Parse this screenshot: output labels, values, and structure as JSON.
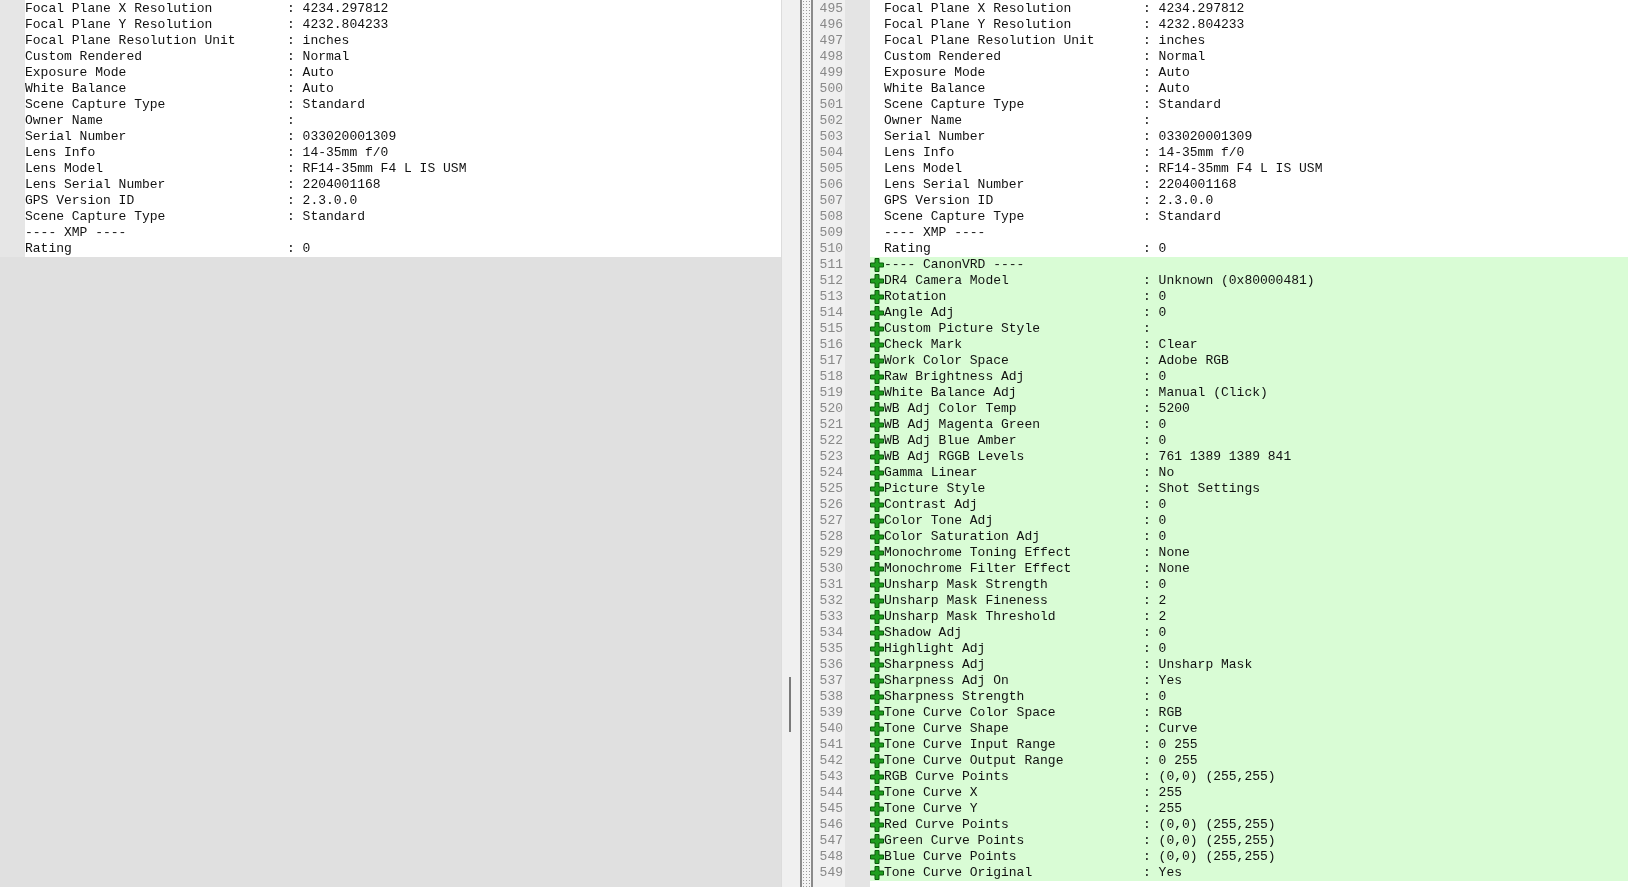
{
  "left_pane": {
    "lines": [
      {
        "key": "Focal Plane X Resolution",
        "value": ": 4234.297812"
      },
      {
        "key": "Focal Plane Y Resolution",
        "value": ": 4232.804233"
      },
      {
        "key": "Focal Plane Resolution Unit",
        "value": ": inches"
      },
      {
        "key": "Custom Rendered",
        "value": ": Normal"
      },
      {
        "key": "Exposure Mode",
        "value": ": Auto"
      },
      {
        "key": "White Balance",
        "value": ": Auto"
      },
      {
        "key": "Scene Capture Type",
        "value": ": Standard"
      },
      {
        "key": "Owner Name",
        "value": ":"
      },
      {
        "key": "Serial Number",
        "value": ": 033020001309"
      },
      {
        "key": "Lens Info",
        "value": ": 14-35mm f/0"
      },
      {
        "key": "Lens Model",
        "value": ": RF14-35mm F4 L IS USM"
      },
      {
        "key": "Lens Serial Number",
        "value": ": 2204001168"
      },
      {
        "key": "GPS Version ID",
        "value": ": 2.3.0.0"
      },
      {
        "key": "Scene Capture Type",
        "value": ": Standard"
      },
      {
        "key": "---- XMP ----"
      },
      {
        "key": "Rating",
        "value": ": 0"
      }
    ]
  },
  "right_pane": {
    "lines": [
      {
        "number": "495",
        "key": "Focal Plane X Resolution",
        "value": ": 4234.297812",
        "added": false
      },
      {
        "number": "496",
        "key": "Focal Plane Y Resolution",
        "value": ": 4232.804233",
        "added": false
      },
      {
        "number": "497",
        "key": "Focal Plane Resolution Unit",
        "value": ": inches",
        "added": false
      },
      {
        "number": "498",
        "key": "Custom Rendered",
        "value": ": Normal",
        "added": false
      },
      {
        "number": "499",
        "key": "Exposure Mode",
        "value": ": Auto",
        "added": false
      },
      {
        "number": "500",
        "key": "White Balance",
        "value": ": Auto",
        "added": false
      },
      {
        "number": "501",
        "key": "Scene Capture Type",
        "value": ": Standard",
        "added": false
      },
      {
        "number": "502",
        "key": "Owner Name",
        "value": ":",
        "added": false
      },
      {
        "number": "503",
        "key": "Serial Number",
        "value": ": 033020001309",
        "added": false
      },
      {
        "number": "504",
        "key": "Lens Info",
        "value": ": 14-35mm f/0",
        "added": false
      },
      {
        "number": "505",
        "key": "Lens Model",
        "value": ": RF14-35mm F4 L IS USM",
        "added": false
      },
      {
        "number": "506",
        "key": "Lens Serial Number",
        "value": ": 2204001168",
        "added": false
      },
      {
        "number": "507",
        "key": "GPS Version ID",
        "value": ": 2.3.0.0",
        "added": false
      },
      {
        "number": "508",
        "key": "Scene Capture Type",
        "value": ": Standard",
        "added": false
      },
      {
        "number": "509",
        "key": "---- XMP ----",
        "added": false
      },
      {
        "number": "510",
        "key": "Rating",
        "value": ": 0",
        "added": false
      },
      {
        "number": "511",
        "key": "---- CanonVRD ----",
        "added": true
      },
      {
        "number": "512",
        "key": "DR4 Camera Model",
        "value": ": Unknown (0x80000481)",
        "added": true
      },
      {
        "number": "513",
        "key": "Rotation",
        "value": ": 0",
        "added": true
      },
      {
        "number": "514",
        "key": "Angle Adj",
        "value": ": 0",
        "added": true
      },
      {
        "number": "515",
        "key": "Custom Picture Style",
        "value": ":",
        "added": true
      },
      {
        "number": "516",
        "key": "Check Mark",
        "value": ": Clear",
        "added": true
      },
      {
        "number": "517",
        "key": "Work Color Space",
        "value": ": Adobe RGB",
        "added": true
      },
      {
        "number": "518",
        "key": "Raw Brightness Adj",
        "value": ": 0",
        "added": true
      },
      {
        "number": "519",
        "key": "White Balance Adj",
        "value": ": Manual (Click)",
        "added": true
      },
      {
        "number": "520",
        "key": "WB Adj Color Temp",
        "value": ": 5200",
        "added": true
      },
      {
        "number": "521",
        "key": "WB Adj Magenta Green",
        "value": ": 0",
        "added": true
      },
      {
        "number": "522",
        "key": "WB Adj Blue Amber",
        "value": ": 0",
        "added": true
      },
      {
        "number": "523",
        "key": "WB Adj RGGB Levels",
        "value": ": 761 1389 1389 841",
        "added": true
      },
      {
        "number": "524",
        "key": "Gamma Linear",
        "value": ": No",
        "added": true
      },
      {
        "number": "525",
        "key": "Picture Style",
        "value": ": Shot Settings",
        "added": true
      },
      {
        "number": "526",
        "key": "Contrast Adj",
        "value": ": 0",
        "added": true
      },
      {
        "number": "527",
        "key": "Color Tone Adj",
        "value": ": 0",
        "added": true
      },
      {
        "number": "528",
        "key": "Color Saturation Adj",
        "value": ": 0",
        "added": true
      },
      {
        "number": "529",
        "key": "Monochrome Toning Effect",
        "value": ": None",
        "added": true
      },
      {
        "number": "530",
        "key": "Monochrome Filter Effect",
        "value": ": None",
        "added": true
      },
      {
        "number": "531",
        "key": "Unsharp Mask Strength",
        "value": ": 0",
        "added": true
      },
      {
        "number": "532",
        "key": "Unsharp Mask Fineness",
        "value": ": 2",
        "added": true
      },
      {
        "number": "533",
        "key": "Unsharp Mask Threshold",
        "value": ": 2",
        "added": true
      },
      {
        "number": "534",
        "key": "Shadow Adj",
        "value": ": 0",
        "added": true
      },
      {
        "number": "535",
        "key": "Highlight Adj",
        "value": ": 0",
        "added": true
      },
      {
        "number": "536",
        "key": "Sharpness Adj",
        "value": ": Unsharp Mask",
        "added": true
      },
      {
        "number": "537",
        "key": "Sharpness Adj On",
        "value": ": Yes",
        "added": true
      },
      {
        "number": "538",
        "key": "Sharpness Strength",
        "value": ": 0",
        "added": true
      },
      {
        "number": "539",
        "key": "Tone Curve Color Space",
        "value": ": RGB",
        "added": true
      },
      {
        "number": "540",
        "key": "Tone Curve Shape",
        "value": ": Curve",
        "added": true
      },
      {
        "number": "541",
        "key": "Tone Curve Input Range",
        "value": ": 0 255",
        "added": true
      },
      {
        "number": "542",
        "key": "Tone Curve Output Range",
        "value": ": 0 255",
        "added": true
      },
      {
        "number": "543",
        "key": "RGB Curve Points",
        "value": ": (0,0) (255,255)",
        "added": true
      },
      {
        "number": "544",
        "key": "Tone Curve X",
        "value": ": 255",
        "added": true
      },
      {
        "number": "545",
        "key": "Tone Curve Y",
        "value": ": 255",
        "added": true
      },
      {
        "number": "546",
        "key": "Red Curve Points",
        "value": ": (0,0) (255,255)",
        "added": true
      },
      {
        "number": "547",
        "key": "Green Curve Points",
        "value": ": (0,0) (255,255)",
        "added": true
      },
      {
        "number": "548",
        "key": "Blue Curve Points",
        "value": ": (0,0) (255,255)",
        "added": true
      },
      {
        "number": "549",
        "key": "Tone Curve Original",
        "value": ": Yes",
        "added": true
      }
    ]
  }
}
